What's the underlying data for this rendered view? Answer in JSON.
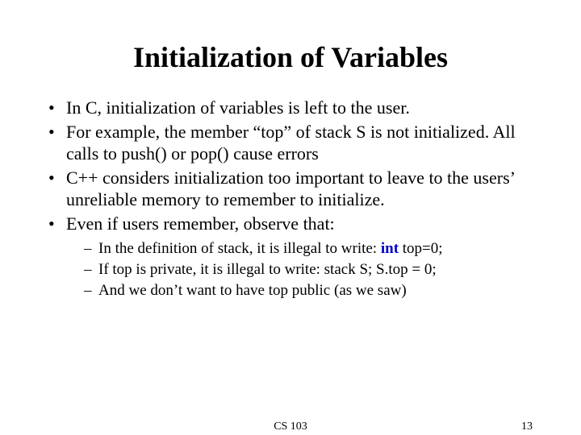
{
  "title": "Initialization of Variables",
  "bullets": [
    "In C, initialization of variables is left to the user.",
    "For example, the member “top” of stack S is not initialized. All calls to push() or pop() cause errors",
    "C++ considers initialization too important to leave to the users’ unreliable memory to remember to initialize.",
    "Even if users remember, observe that:"
  ],
  "sub_bullets": {
    "prefix0": "In the definition of stack, it is illegal to write: ",
    "keyword0": "int",
    "suffix0": " top=0;",
    "item1": "If top is private, it is illegal to write: stack S; S.top = 0;",
    "item2": "And we don’t want to have top public (as we saw)"
  },
  "footer": {
    "course": "CS 103",
    "page": "13"
  }
}
